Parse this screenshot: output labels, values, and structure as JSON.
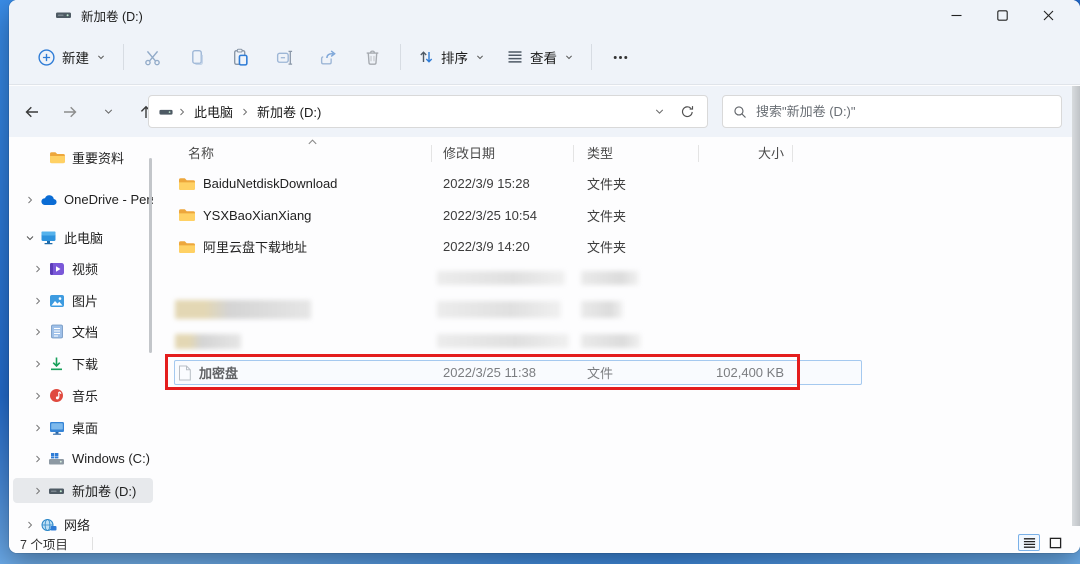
{
  "window": {
    "title": "新加卷 (D:)"
  },
  "toolbar": {
    "new_label": "新建",
    "sort_label": "排序",
    "view_label": "查看"
  },
  "navbar": {
    "breadcrumb": {
      "root": "此电脑",
      "current": "新加卷 (D:)"
    },
    "search_placeholder": "搜索\"新加卷 (D:)\""
  },
  "sidebar": {
    "items": [
      {
        "label": "重要资料"
      },
      {
        "label": "OneDrive - Pers"
      },
      {
        "label": "此电脑"
      },
      {
        "label": "视频"
      },
      {
        "label": "图片"
      },
      {
        "label": "文档"
      },
      {
        "label": "下载"
      },
      {
        "label": "音乐"
      },
      {
        "label": "桌面"
      },
      {
        "label": "Windows (C:)"
      },
      {
        "label": "新加卷 (D:)",
        "selected": true
      },
      {
        "label": "网络"
      }
    ]
  },
  "filelist": {
    "columns": [
      "名称",
      "修改日期",
      "类型",
      "大小"
    ],
    "sorted_by": "名称",
    "sort_ascending": true,
    "rows": [
      {
        "name": "BaiduNetdiskDownload",
        "date": "2022/3/9 15:28",
        "type": "文件夹",
        "size": ""
      },
      {
        "name": "YSXBaoXianXiang",
        "date": "2022/3/25 10:54",
        "type": "文件夹",
        "size": ""
      },
      {
        "name": "阿里云盘下载地址",
        "date": "2022/3/9 14:20",
        "type": "文件夹",
        "size": ""
      },
      {
        "name": "加密盘",
        "date": "2022/3/25 11:38",
        "type": "文件",
        "size": "102,400 KB",
        "selected": true,
        "annotated": true
      }
    ],
    "redacted_rows": 3
  },
  "statusbar": {
    "item_count": "7 个项目"
  },
  "colors": {
    "accent": "#2f7cd6",
    "annotation": "#e41d1d",
    "selection_border": "#a5c9ef",
    "chrome": "#eff3f9"
  }
}
